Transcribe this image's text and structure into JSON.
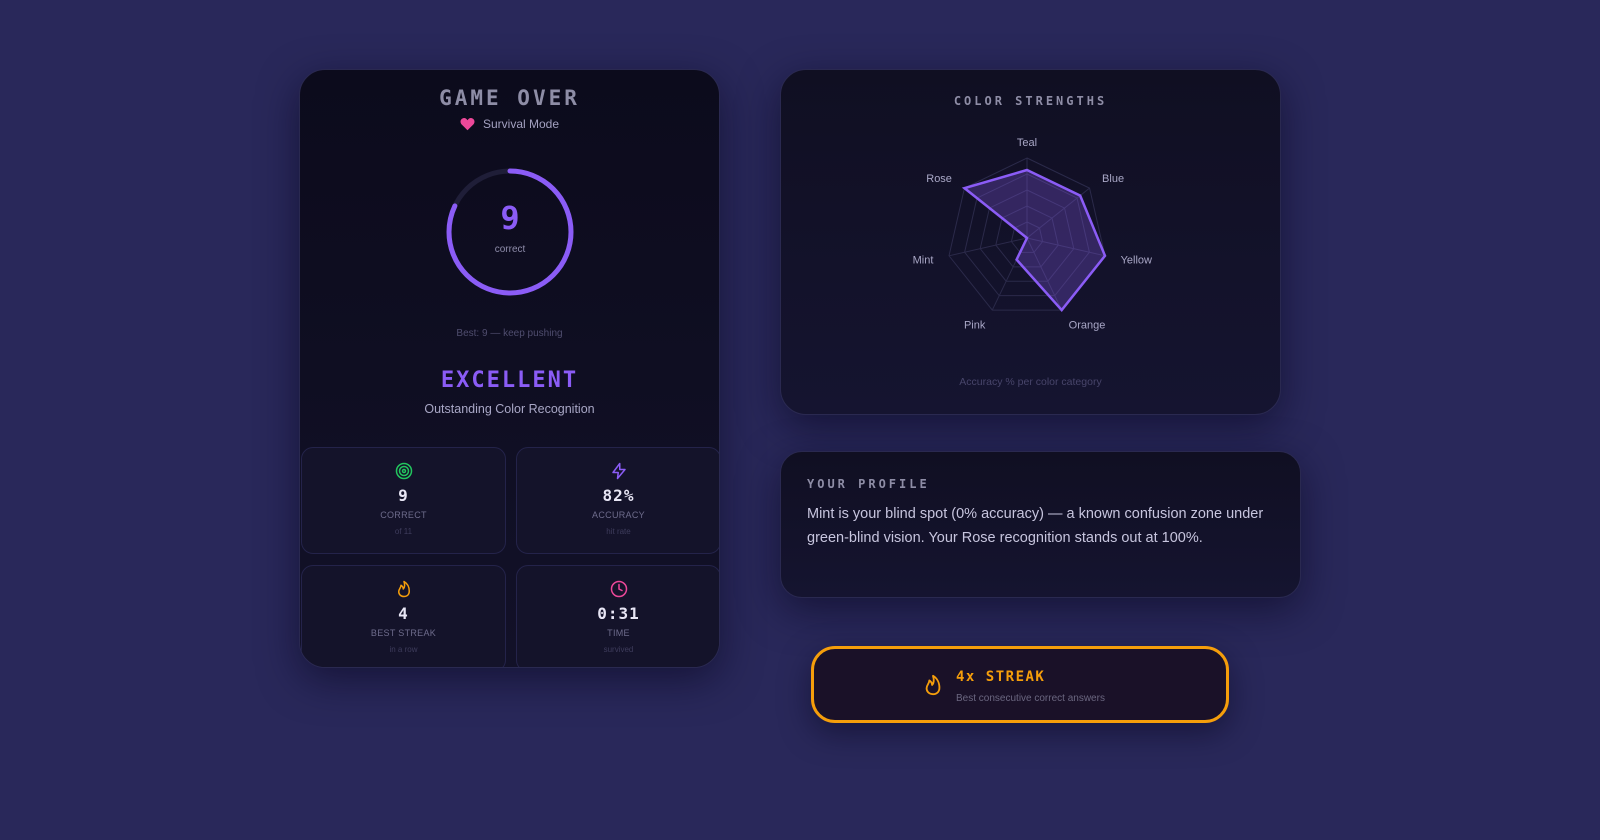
{
  "summary": {
    "title": "GAME OVER",
    "mode": "Survival Mode",
    "score": "9",
    "score_label": "correct",
    "score_progress": 0.82,
    "best_line": "Best: 9 — keep pushing",
    "rating": "EXCELLENT",
    "rating_sub": "Outstanding Color Recognition"
  },
  "stats": [
    {
      "icon": "target-icon",
      "value": "9",
      "label": "CORRECT",
      "sub": "of 11",
      "color": "#22c55e"
    },
    {
      "icon": "lightning-icon",
      "value": "82%",
      "label": "ACCURACY",
      "sub": "hit rate",
      "color": "#8b5cf6"
    },
    {
      "icon": "flame-icon",
      "value": "4",
      "label": "BEST STREAK",
      "sub": "in a row",
      "color": "#f59e0b"
    },
    {
      "icon": "clock-icon",
      "value": "0:31",
      "label": "TIME",
      "sub": "survived",
      "color": "#ec4899"
    }
  ],
  "chart_data": {
    "type": "radar",
    "title": "COLOR STRENGTHS",
    "caption": "Accuracy % per color category",
    "categories": [
      "Teal",
      "Blue",
      "Yellow",
      "Orange",
      "Pink",
      "Mint",
      "Rose"
    ],
    "values": [
      85,
      85,
      100,
      100,
      30,
      0,
      100
    ],
    "max": 100,
    "grid_levels": 5,
    "color": "#8b5cf6"
  },
  "profile": {
    "title": "YOUR PROFILE",
    "text": "Mint is your blind spot (0% accuracy) — a known confusion zone under green-blind vision. Your Rose recognition stands out at 100%."
  },
  "streak": {
    "title": "4x STREAK",
    "sub": "Best consecutive correct answers",
    "color": "#f59e0b"
  },
  "colors": {
    "background": "#29285a",
    "accent": "#8b5cf6",
    "heart": "#ec4899"
  }
}
